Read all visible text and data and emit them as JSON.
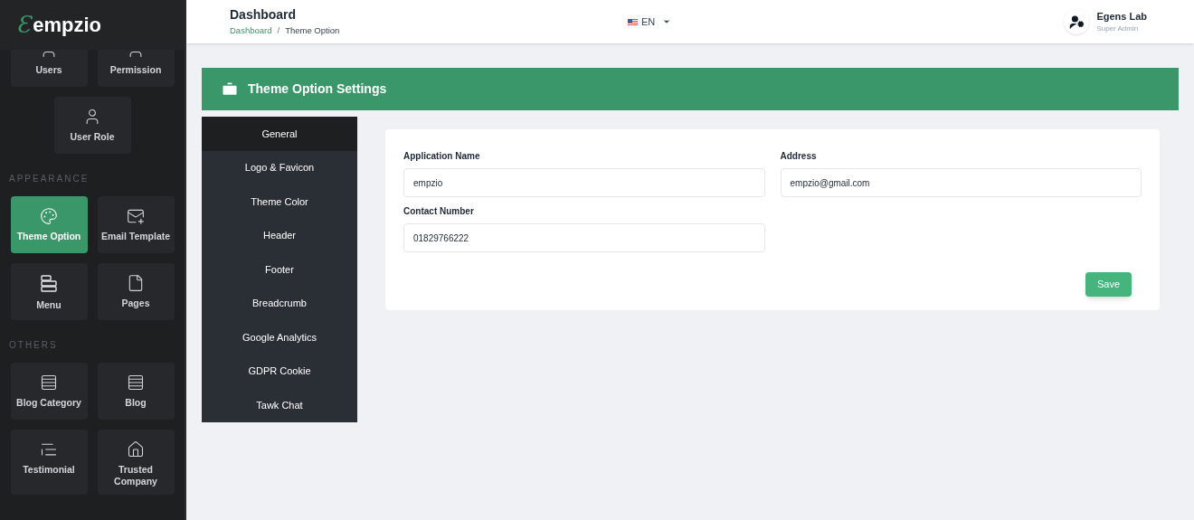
{
  "logo": {
    "mark": "Ɛ",
    "text": "empzio"
  },
  "sidebar": {
    "sections": [
      {
        "items": [
          {
            "label": "Users",
            "selected": false
          },
          {
            "label": "Permission",
            "selected": false
          },
          {
            "label": "User Role",
            "selected": false
          }
        ]
      },
      {
        "heading": "APPEARANCE",
        "items": [
          {
            "label": "Theme Option",
            "selected": true
          },
          {
            "label": "Email Template",
            "selected": false
          },
          {
            "label": "Menu",
            "selected": false
          },
          {
            "label": "Pages",
            "selected": false
          }
        ]
      },
      {
        "heading": "OTHERS",
        "items": [
          {
            "label": "Blog Category",
            "selected": false
          },
          {
            "label": "Blog",
            "selected": false
          },
          {
            "label": "Testimonial",
            "selected": false
          },
          {
            "label": "Trusted Company",
            "selected": false
          }
        ]
      }
    ]
  },
  "header": {
    "title": "Dashboard",
    "breadcrumb": [
      "Dashboard",
      "Theme Option"
    ],
    "separator": "/",
    "language": "EN",
    "user": {
      "name": "Egens Lab",
      "role": "Super Admin"
    }
  },
  "panel": {
    "title": "Theme Option Settings",
    "tabs": [
      {
        "label": "General",
        "selected": true
      },
      {
        "label": "Logo & Favicon",
        "selected": false
      },
      {
        "label": "Theme Color",
        "selected": false
      },
      {
        "label": "Header",
        "selected": false
      },
      {
        "label": "Footer",
        "selected": false
      },
      {
        "label": "Breadcrumb",
        "selected": false
      },
      {
        "label": "Google Analytics",
        "selected": false
      },
      {
        "label": "GDPR Cookie",
        "selected": false
      },
      {
        "label": "Tawk Chat",
        "selected": false
      }
    ],
    "fields": [
      {
        "label": "Application Name",
        "value": "empzio"
      },
      {
        "label": "Address",
        "value": "empzio@gmail.com"
      },
      {
        "label": "Contact Number",
        "value": "01829766222"
      }
    ],
    "save_button": "Save"
  }
}
